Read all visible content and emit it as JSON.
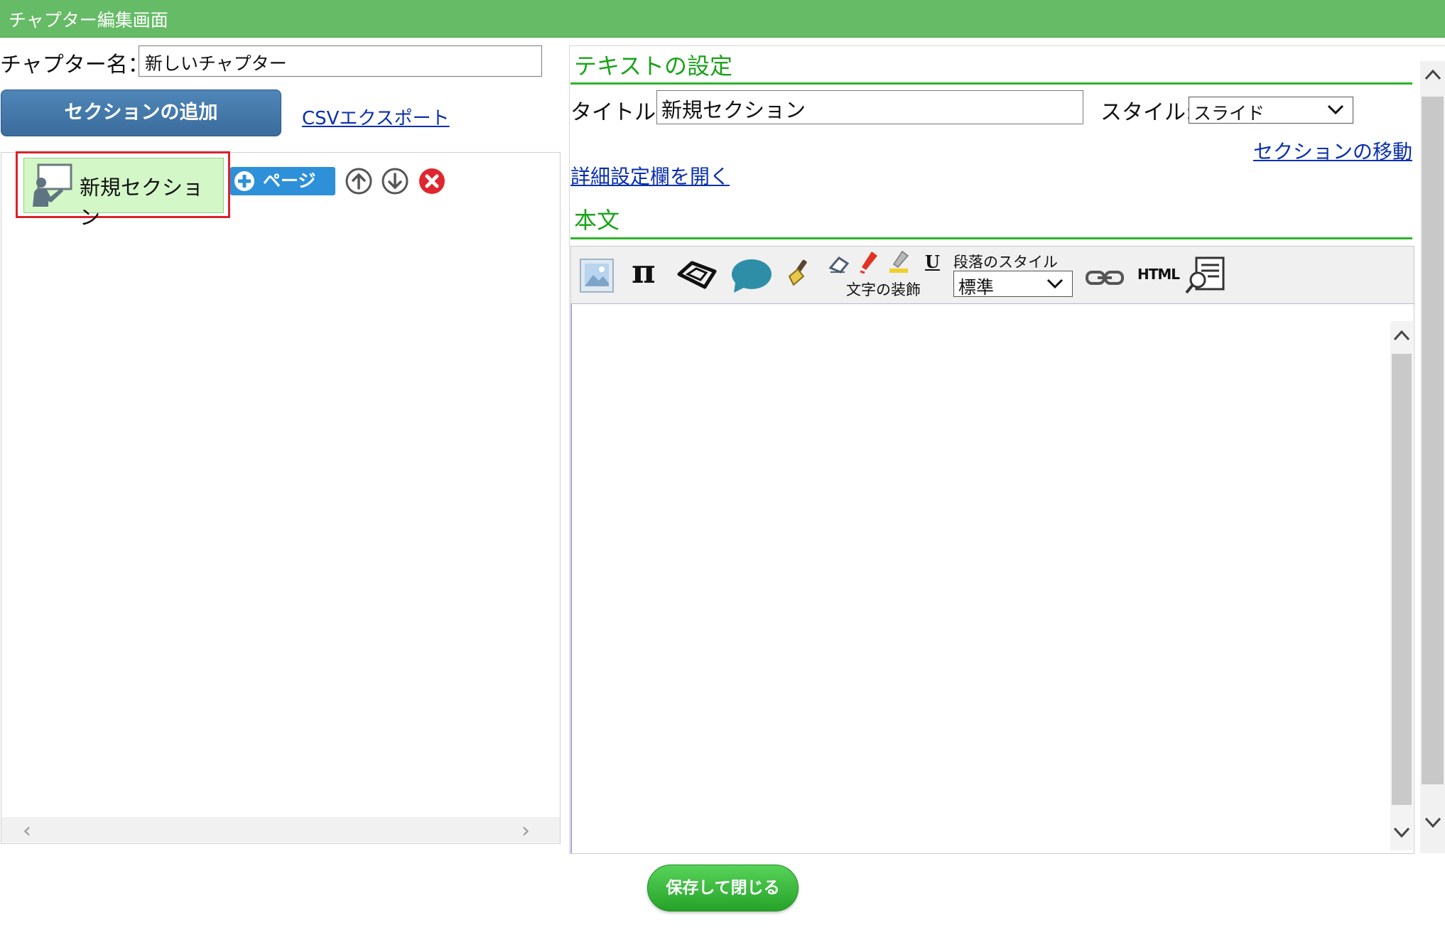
{
  "window": {
    "title": "チャプター編集画面"
  },
  "left": {
    "chapter_name_label": "チャプター名：",
    "chapter_name_value": "新しいチャプター",
    "add_section_button": "セクションの追加",
    "csv_export_link": "CSVエクスポート",
    "tree": {
      "section_label": "新規セクション",
      "page_button": "ページ"
    }
  },
  "right": {
    "text_settings_heading": "テキストの設定",
    "title_label": "タイトル:",
    "title_value": "新規セクション",
    "style_label": "スタイル:",
    "style_value": "スライド",
    "move_section_link": "セクションの移動",
    "detail_settings_link": "詳細設定欄を開く",
    "body_heading": "本文",
    "toolbar": {
      "text_decoration_label": "文字の装飾",
      "paragraph_style_label": "段落のスタイル",
      "paragraph_style_value": "標準",
      "underline_glyph": "U",
      "html_label": "HTML",
      "pi_glyph": "π"
    }
  },
  "footer": {
    "save_close_button": "保存して閉じる"
  },
  "colors": {
    "titlebar": "#66bb66",
    "heading_green": "#1aa31a",
    "add_button": "#3a6c9c",
    "page_button": "#2d90d9",
    "save_button": "#26a229",
    "section_bg": "#d4f7c8",
    "selection_border": "#d9232a",
    "link": "#0a2fb0"
  }
}
